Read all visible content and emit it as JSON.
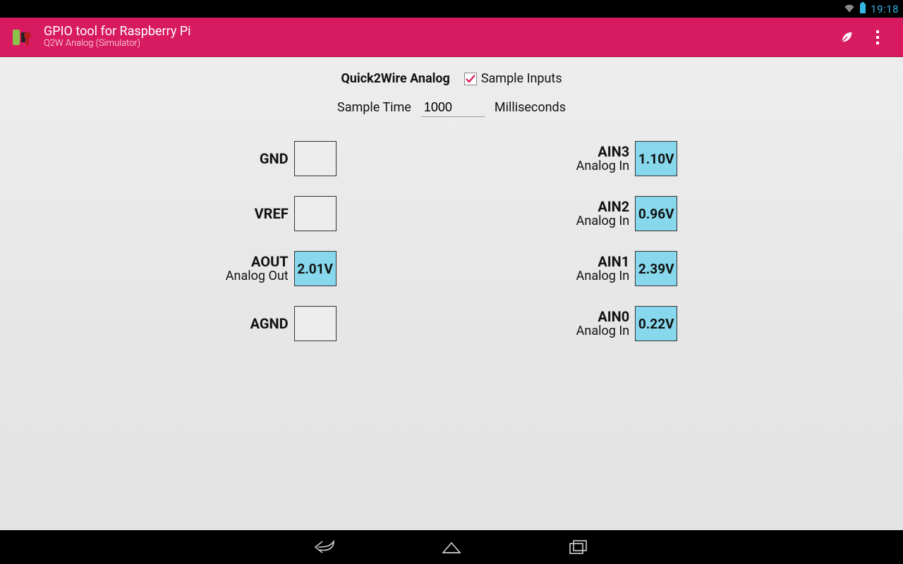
{
  "status": {
    "clock": "19:18"
  },
  "appbar": {
    "title": "GPIO tool for Raspberry Pi",
    "subtitle": "Q2W Analog (Simulator)"
  },
  "header": {
    "title": "Quick2Wire Analog",
    "checkbox_label": "Sample Inputs",
    "checked": true
  },
  "sample": {
    "label": "Sample Time",
    "value": "1000",
    "unit": "Milliseconds"
  },
  "left_pins": [
    {
      "name": "GND",
      "sub": "",
      "value": "",
      "active": false
    },
    {
      "name": "VREF",
      "sub": "",
      "value": "",
      "active": false
    },
    {
      "name": "AOUT",
      "sub": "Analog Out",
      "value": "2.01V",
      "active": true
    },
    {
      "name": "AGND",
      "sub": "",
      "value": "",
      "active": false
    }
  ],
  "right_pins": [
    {
      "name": "AIN3",
      "sub": "Analog In",
      "value": "1.10V",
      "active": true
    },
    {
      "name": "AIN2",
      "sub": "Analog In",
      "value": "0.96V",
      "active": true
    },
    {
      "name": "AIN1",
      "sub": "Analog In",
      "value": "2.39V",
      "active": true
    },
    {
      "name": "AIN0",
      "sub": "Analog In",
      "value": "0.22V",
      "active": true
    }
  ]
}
